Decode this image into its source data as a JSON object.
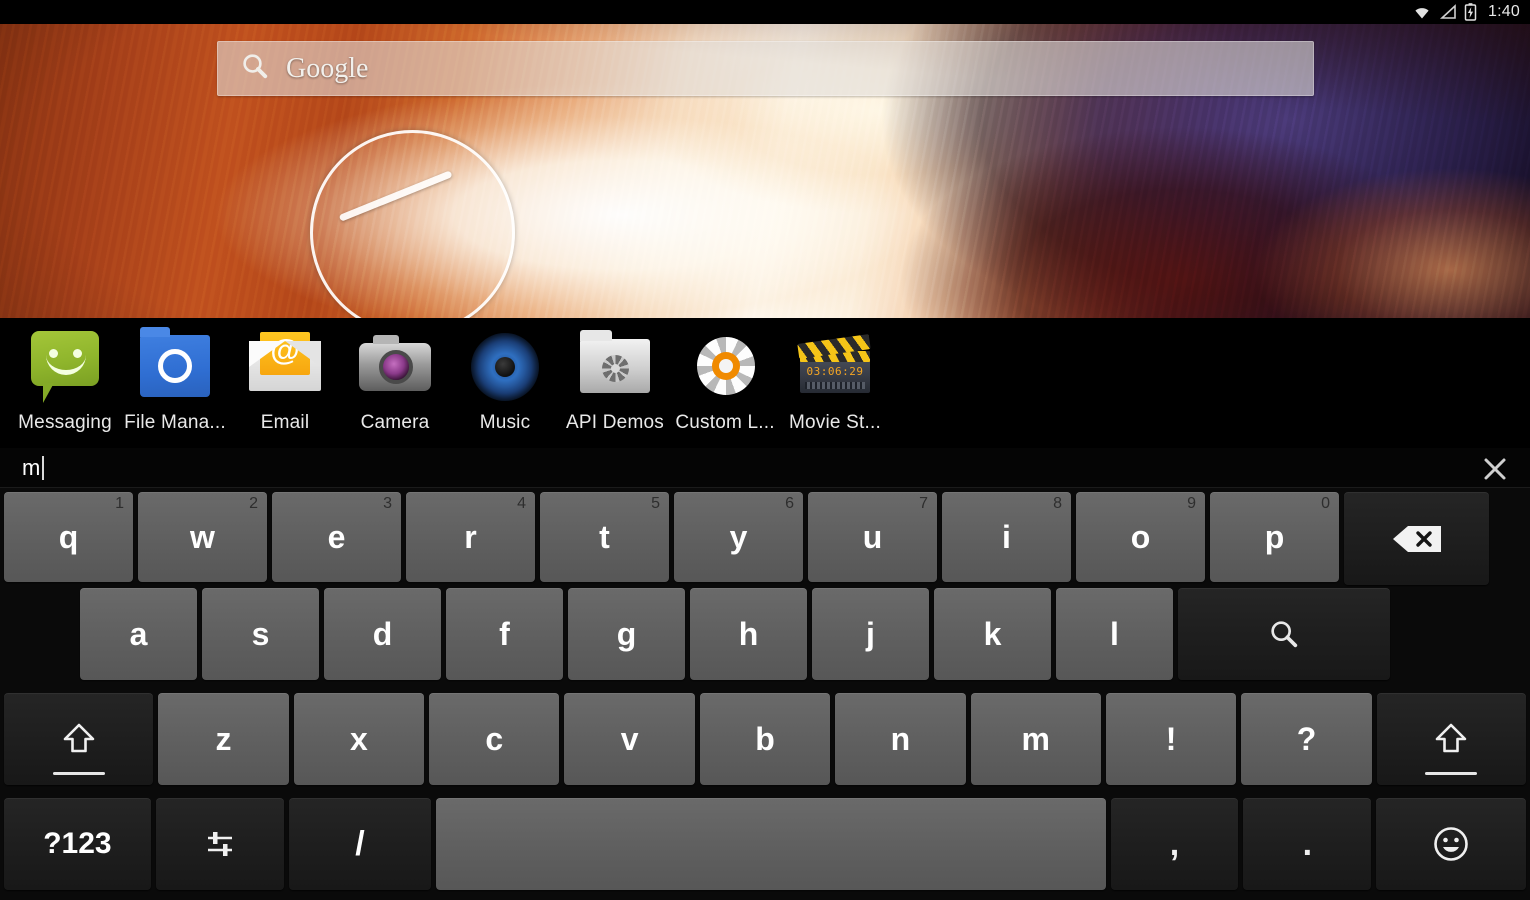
{
  "statusbar": {
    "time": "1:40",
    "icons": [
      "wifi-icon",
      "signal-icon",
      "battery-icon"
    ]
  },
  "search": {
    "logo_text": "Google",
    "icon": "search-icon",
    "placeholder": "Google"
  },
  "homescreen": {
    "wallpaper": "antelope-canyon-photo",
    "widget": "analog-clock-widget",
    "colors": {
      "sandstone_light": "#fffdf8",
      "sandstone_orange": "#c2531f",
      "shadow_purple": "#3b2248",
      "maroon": "#561210"
    }
  },
  "apps": [
    {
      "label": "Messaging",
      "icon": "messaging-icon"
    },
    {
      "label": "File Mana...",
      "icon": "file-manager-icon"
    },
    {
      "label": "Email",
      "icon": "email-icon"
    },
    {
      "label": "Camera",
      "icon": "camera-icon"
    },
    {
      "label": "Music",
      "icon": "music-icon"
    },
    {
      "label": "API Demos",
      "icon": "api-demos-icon"
    },
    {
      "label": "Custom L...",
      "icon": "custom-locale-icon"
    },
    {
      "label": "Movie St...",
      "icon": "movie-studio-icon",
      "timecode": "03:06:29"
    }
  ],
  "composer": {
    "text": "m",
    "close_icon": "close-icon"
  },
  "keyboard": {
    "rows": [
      {
        "id": "row-1",
        "keys": [
          {
            "label": "q",
            "hint": "1",
            "style": "light",
            "size": "k-std",
            "name": "key-q"
          },
          {
            "label": "w",
            "hint": "2",
            "style": "light",
            "size": "k-std",
            "name": "key-w"
          },
          {
            "label": "e",
            "hint": "3",
            "style": "light",
            "size": "k-std",
            "name": "key-e"
          },
          {
            "label": "r",
            "hint": "4",
            "style": "light",
            "size": "k-std",
            "name": "key-r"
          },
          {
            "label": "t",
            "hint": "5",
            "style": "light",
            "size": "k-std",
            "name": "key-t"
          },
          {
            "label": "y",
            "hint": "6",
            "style": "light",
            "size": "k-std",
            "name": "key-y"
          },
          {
            "label": "u",
            "hint": "7",
            "style": "light",
            "size": "k-std",
            "name": "key-u"
          },
          {
            "label": "i",
            "hint": "8",
            "style": "light",
            "size": "k-std",
            "name": "key-i"
          },
          {
            "label": "o",
            "hint": "9",
            "style": "light",
            "size": "k-std",
            "name": "key-o"
          },
          {
            "label": "p",
            "hint": "0",
            "style": "light",
            "size": "k-std",
            "name": "key-p"
          },
          {
            "label": "",
            "icon": "backspace-icon",
            "style": "dark",
            "size": "k-bksp",
            "name": "key-backspace"
          }
        ]
      },
      {
        "id": "row-2",
        "keys": [
          {
            "label": "a",
            "style": "light",
            "size": "k-home",
            "name": "key-a"
          },
          {
            "label": "s",
            "style": "light",
            "size": "k-home",
            "name": "key-s"
          },
          {
            "label": "d",
            "style": "light",
            "size": "k-home",
            "name": "key-d"
          },
          {
            "label": "f",
            "style": "light",
            "size": "k-home",
            "name": "key-f"
          },
          {
            "label": "g",
            "style": "light",
            "size": "k-home",
            "name": "key-g"
          },
          {
            "label": "h",
            "style": "light",
            "size": "k-home",
            "name": "key-h"
          },
          {
            "label": "j",
            "style": "light",
            "size": "k-home",
            "name": "key-j"
          },
          {
            "label": "k",
            "style": "light",
            "size": "k-home",
            "name": "key-k"
          },
          {
            "label": "l",
            "style": "light",
            "size": "k-home",
            "name": "key-l"
          },
          {
            "label": "",
            "icon": "search-icon",
            "style": "dark",
            "size": "k-enter",
            "name": "key-search-enter"
          }
        ]
      },
      {
        "id": "row-3",
        "keys": [
          {
            "label": "",
            "icon": "shift-icon",
            "style": "dark",
            "size": "k-shiftL",
            "name": "key-shift-left"
          },
          {
            "label": "z",
            "style": "light",
            "size": "k-z",
            "name": "key-z"
          },
          {
            "label": "x",
            "style": "light",
            "size": "k-z",
            "name": "key-x"
          },
          {
            "label": "c",
            "style": "light",
            "size": "k-z",
            "name": "key-c"
          },
          {
            "label": "v",
            "style": "light",
            "size": "k-z",
            "name": "key-v"
          },
          {
            "label": "b",
            "style": "light",
            "size": "k-z",
            "name": "key-b"
          },
          {
            "label": "n",
            "style": "light",
            "size": "k-z",
            "name": "key-n"
          },
          {
            "label": "m",
            "style": "light",
            "size": "k-z",
            "name": "key-m"
          },
          {
            "label": "!",
            "style": "light",
            "size": "k-z",
            "name": "key-exclamation"
          },
          {
            "label": "?",
            "style": "light",
            "size": "k-z",
            "name": "key-question"
          },
          {
            "label": "",
            "icon": "shift-icon",
            "style": "dark",
            "size": "k-shiftR",
            "name": "key-shift-right"
          }
        ]
      },
      {
        "id": "row-4",
        "keys": [
          {
            "label": "?123",
            "style": "dark",
            "size": "k-123",
            "name": "key-symbols"
          },
          {
            "label": "",
            "icon": "settings-sliders-icon",
            "style": "dark",
            "size": "k-opt",
            "name": "key-ime-options"
          },
          {
            "label": "/",
            "style": "dark",
            "size": "k-slash",
            "name": "key-slash"
          },
          {
            "label": "",
            "style": "light",
            "size": "k-space",
            "name": "key-space"
          },
          {
            "label": ",",
            "style": "dark",
            "size": "k-punct",
            "name": "key-comma"
          },
          {
            "label": ".",
            "style": "dark",
            "size": "k-punct",
            "name": "key-period"
          },
          {
            "label": "",
            "icon": "emoji-icon",
            "style": "dark",
            "size": "k-emoji",
            "name": "key-emoji"
          }
        ]
      }
    ]
  }
}
